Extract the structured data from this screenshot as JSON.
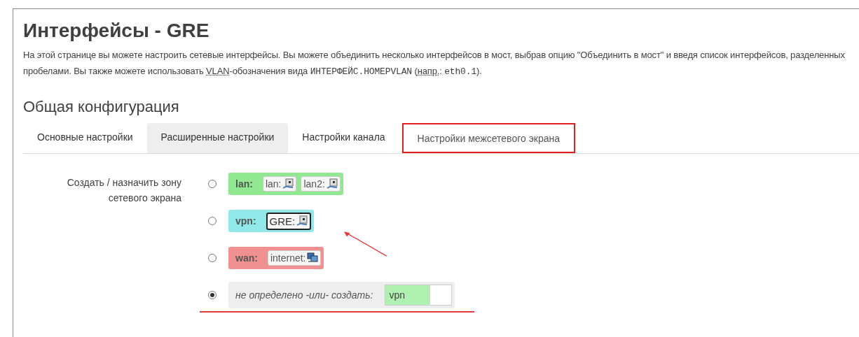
{
  "title": "Интерфейсы - GRE",
  "description": [
    {
      "kind": "text",
      "text": "На этой странице вы можете настроить сетевые интерфейсы. Вы можете объединить несколько интерфейсов в мост, выбрав опцию \"Объединить в мост\" и введя список интерфейсов, разделенных пробелами. Вы также можете использовать "
    },
    {
      "kind": "abbr",
      "text": "VLAN"
    },
    {
      "kind": "text",
      "text": "-обозначения вида "
    },
    {
      "kind": "code",
      "text": "ИНТЕРФЕЙС.НОМЕРVLAN"
    },
    {
      "kind": "text",
      "text": " ("
    },
    {
      "kind": "abbr",
      "text": "напр."
    },
    {
      "kind": "text",
      "text": ": "
    },
    {
      "kind": "code",
      "text": "eth0.1"
    },
    {
      "kind": "text",
      "text": ")."
    }
  ],
  "section_title": "Общая конфигурация",
  "tabs": [
    {
      "label": "Основные настройки",
      "selected": false,
      "highlighted": false
    },
    {
      "label": "Расширенные настройки",
      "selected": true,
      "highlighted": false
    },
    {
      "label": "Настройки канала",
      "selected": false,
      "highlighted": false
    },
    {
      "label": "Настройки межсетевого экрана",
      "selected": false,
      "highlighted": true
    }
  ],
  "field_label": "Создать / назначить зону сетевого экрана",
  "arrow": true,
  "options": [
    {
      "kind": "zone",
      "selected": false,
      "name": "lan:",
      "color": "#90e890",
      "networks": [
        {
          "label": "lan:",
          "kind": "ethernet",
          "highlighted": false
        },
        {
          "label": "lan2:",
          "kind": "ethernet",
          "highlighted": false
        }
      ]
    },
    {
      "kind": "zone",
      "selected": false,
      "name": "vpn:",
      "color": "#90e8e8",
      "networks": [
        {
          "label": "GRE:",
          "kind": "ethernet",
          "highlighted": true
        }
      ]
    },
    {
      "kind": "zone",
      "selected": false,
      "name": "wan:",
      "color": "#f09090",
      "networks": [
        {
          "label": "internet:",
          "kind": "computers",
          "highlighted": false
        }
      ]
    },
    {
      "kind": "create",
      "selected": true,
      "label": "не определено -или- создать:",
      "value": "vpn",
      "underlined": true
    }
  ]
}
